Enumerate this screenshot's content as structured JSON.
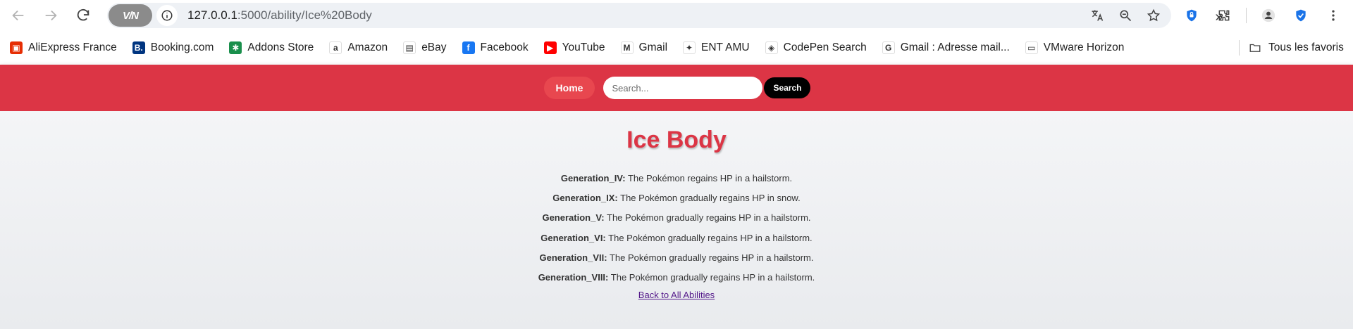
{
  "browser": {
    "vpn_label": "V/N",
    "url_host": "127.0.0.1",
    "url_path": ":5000/ability/Ice%20Body",
    "bookmarks": [
      {
        "label": "AliExpress France",
        "icon": "aliexpress-icon",
        "color": "#e62e04",
        "glyph": "▣"
      },
      {
        "label": "Booking.com",
        "icon": "booking-icon",
        "color": "#003580",
        "glyph": "B."
      },
      {
        "label": "Addons Store",
        "icon": "addons-icon",
        "color": "#1a8f4c",
        "glyph": "✱"
      },
      {
        "label": "Amazon",
        "icon": "amazon-icon",
        "color": "#ffffff",
        "glyph": "a"
      },
      {
        "label": "eBay",
        "icon": "ebay-icon",
        "color": "#ffffff",
        "glyph": "▤"
      },
      {
        "label": "Facebook",
        "icon": "facebook-icon",
        "color": "#1877f2",
        "glyph": "f"
      },
      {
        "label": "YouTube",
        "icon": "youtube-icon",
        "color": "#ff0000",
        "glyph": "▶"
      },
      {
        "label": "Gmail",
        "icon": "gmail-icon",
        "color": "#ffffff",
        "glyph": "M"
      },
      {
        "label": "ENT AMU",
        "icon": "ent-amu-icon",
        "color": "#ffffff",
        "glyph": "✦"
      },
      {
        "label": "CodePen Search",
        "icon": "codepen-icon",
        "color": "#ffffff",
        "glyph": "◈"
      },
      {
        "label": "Gmail : Adresse mail...",
        "icon": "google-icon",
        "color": "#ffffff",
        "glyph": "G"
      },
      {
        "label": "VMware Horizon",
        "icon": "vmware-horizon-icon",
        "color": "#ffffff",
        "glyph": "▭"
      }
    ],
    "all_bookmarks_label": "Tous les favoris"
  },
  "nav": {
    "home_label": "Home",
    "search_placeholder": "Search...",
    "search_button": "Search"
  },
  "ability": {
    "name": "Ice Body",
    "generations": [
      {
        "gen": "Generation_IV:",
        "text": "The Pokémon regains HP in a hailstorm."
      },
      {
        "gen": "Generation_IX:",
        "text": "The Pokémon gradually regains HP in snow."
      },
      {
        "gen": "Generation_V:",
        "text": "The Pokémon gradually regains HP in a hailstorm."
      },
      {
        "gen": "Generation_VI:",
        "text": "The Pokémon gradually regains HP in a hailstorm."
      },
      {
        "gen": "Generation_VII:",
        "text": "The Pokémon gradually regains HP in a hailstorm."
      },
      {
        "gen": "Generation_VIII:",
        "text": "The Pokémon gradually regains HP in a hailstorm."
      }
    ],
    "back_link": "Back to All Abilities"
  },
  "colors": {
    "brand_red": "#dc3545",
    "search_button_bg": "#000000",
    "visited_link": "#551a8b"
  }
}
